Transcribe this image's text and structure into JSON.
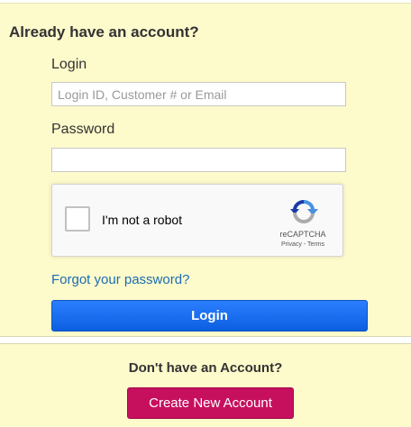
{
  "login_section": {
    "heading": "Already have an account?",
    "login_label": "Login",
    "login_placeholder": "Login ID, Customer # or Email",
    "login_value": "",
    "password_label": "Password",
    "password_value": "",
    "forgot_link": "Forgot your password?",
    "login_button": "Login"
  },
  "recaptcha": {
    "checkbox_label": "I'm not a robot",
    "checked": false,
    "brand": "reCAPTCHA",
    "terms": "Privacy - Terms",
    "icon": "recaptcha-logo-icon"
  },
  "signup_section": {
    "heading": "Don't have an Account?",
    "create_button": "Create New Account"
  },
  "colors": {
    "panel_background": "#fdfacb",
    "login_button": "#1467ee",
    "create_button": "#c6105e",
    "link": "#1a6db3"
  }
}
